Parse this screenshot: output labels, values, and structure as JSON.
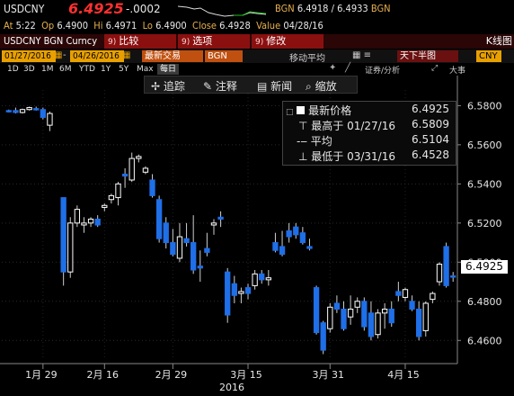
{
  "header": {
    "ticker": "USDCNY",
    "last": "6.4925",
    "change": "-.0002",
    "bid_label": "BGN",
    "bid": "6.4918",
    "ask": "6.4933",
    "ask_src": "BGN",
    "at_label": "At",
    "at_time": "5:22",
    "op_label": "Op",
    "open": "6.4900",
    "hi_label": "Hi",
    "high": "6.4971",
    "lo_label": "Lo",
    "low": "6.4900",
    "close_label": "Close",
    "close": "6.4928",
    "value_label": "Value",
    "value_date": "04/28/16"
  },
  "function_bar": {
    "security": "USDCNY BGN Curncy",
    "buttons": [
      {
        "num": "9)",
        "label": "比较"
      },
      {
        "num": "9)",
        "label": "选项"
      },
      {
        "num": "9)",
        "label": "修改"
      }
    ],
    "chart_label": "K线图"
  },
  "date_row": {
    "start": "01/27/2016",
    "end": "04/26/2016",
    "last_trade": "最新交易",
    "source": "BGN",
    "ma_label": "移动平均",
    "view": "天下半图",
    "currency": "CNY",
    "securities": "证券/分析",
    "zoom": "大事"
  },
  "periods": [
    "1D",
    "3D",
    "1M",
    "6M",
    "YTD",
    "1Y",
    "5Y",
    "Max"
  ],
  "period_selected": "",
  "freq": "每日",
  "toolbar": {
    "track": "追踪",
    "annotate": "注释",
    "news": "新闻",
    "zoom": "缩放"
  },
  "legend": {
    "last_label": "最新价格",
    "last_value": "6.4925",
    "high_label": "最高于 01/27/16",
    "high_value": "6.5809",
    "avg_label": "平均",
    "avg_value": "6.5104",
    "low_label": "最低于 03/31/16",
    "low_value": "6.4528"
  },
  "colors": {
    "up": "#ffffff",
    "down": "#1f6fe8",
    "last_price_color": "#ff3030"
  },
  "chart_data": {
    "type": "candlestick",
    "yticks": [
      "6.5800",
      "6.5600",
      "6.5400",
      "6.5200",
      "6.5000",
      "6.4800",
      "6.4600"
    ],
    "ylim": [
      6.45,
      6.588
    ],
    "xticks": [
      "1月 29",
      "2月 16",
      "2月 29",
      "3月 15",
      "3月 31",
      "4月 15"
    ],
    "x_year": "2016",
    "last_price_label": "6.4925",
    "candles": [
      [
        6.5775,
        6.578,
        6.5765,
        6.577
      ],
      [
        6.5775,
        6.579,
        6.576,
        6.5765
      ],
      [
        6.5765,
        6.5785,
        6.576,
        6.578
      ],
      [
        6.578,
        6.5795,
        6.5775,
        6.579
      ],
      [
        6.5785,
        6.5795,
        6.5775,
        6.578
      ],
      [
        6.578,
        6.579,
        6.573,
        6.574
      ],
      [
        6.57,
        6.577,
        6.567,
        6.576
      ],
      null,
      [
        6.533,
        6.533,
        6.488,
        6.495
      ],
      [
        6.495,
        6.523,
        6.492,
        6.52
      ],
      [
        6.52,
        6.529,
        6.518,
        6.527
      ],
      [
        6.519,
        6.523,
        6.515,
        6.52
      ],
      [
        6.52,
        6.523,
        6.518,
        6.522
      ],
      [
        6.522,
        6.524,
        6.518,
        6.519
      ],
      [
        6.528,
        6.53,
        6.526,
        6.529
      ],
      [
        6.532,
        6.535,
        6.53,
        6.534
      ],
      [
        6.533,
        6.541,
        6.529,
        6.54
      ],
      [
        6.545,
        6.548,
        6.538,
        6.544
      ],
      [
        6.542,
        6.556,
        6.541,
        6.553
      ],
      [
        6.553,
        6.555,
        6.551,
        6.554
      ],
      [
        6.546,
        6.549,
        6.545,
        6.548
      ],
      [
        6.542,
        6.545,
        6.533,
        6.534
      ],
      [
        6.532,
        6.534,
        6.51,
        6.512
      ],
      [
        6.52,
        6.523,
        6.507,
        6.51
      ],
      [
        6.51,
        6.517,
        6.503,
        6.504
      ],
      [
        6.502,
        6.52,
        6.5,
        6.513
      ],
      [
        6.512,
        6.52,
        6.508,
        6.51
      ],
      [
        6.51,
        6.524,
        6.494,
        6.496
      ],
      [
        6.498,
        6.506,
        6.49,
        6.497
      ],
      [
        6.507,
        6.515,
        6.503,
        6.505
      ],
      [
        6.519,
        6.522,
        6.514,
        6.52
      ],
      [
        6.523,
        6.526,
        6.518,
        6.522
      ],
      [
        6.495,
        6.497,
        6.469,
        6.473
      ],
      [
        6.489,
        6.493,
        6.479,
        6.483
      ],
      [
        6.484,
        6.487,
        6.479,
        6.485
      ],
      [
        6.487,
        6.489,
        6.481,
        6.484
      ],
      [
        6.488,
        6.496,
        6.486,
        6.494
      ],
      [
        6.494,
        6.496,
        6.489,
        6.491
      ],
      [
        6.491,
        6.496,
        6.488,
        6.492
      ],
      [
        6.51,
        6.515,
        6.505,
        6.506
      ],
      [
        6.508,
        6.516,
        6.503,
        6.504
      ],
      [
        6.516,
        6.52,
        6.51,
        6.513
      ],
      [
        6.518,
        6.52,
        6.512,
        6.514
      ],
      [
        6.515,
        6.518,
        6.509,
        6.51
      ],
      [
        6.508,
        6.512,
        6.506,
        6.507
      ],
      [
        6.487,
        6.488,
        6.463,
        6.464
      ],
      [
        6.469,
        6.47,
        6.453,
        6.455
      ],
      [
        6.466,
        6.479,
        6.464,
        6.477
      ],
      [
        6.479,
        6.483,
        6.474,
        6.476
      ],
      [
        6.476,
        6.48,
        6.465,
        6.466
      ],
      [
        6.472,
        6.483,
        6.468,
        6.476
      ],
      [
        6.477,
        6.482,
        6.474,
        6.48
      ],
      [
        6.48,
        6.482,
        6.465,
        6.467
      ],
      [
        6.474,
        6.48,
        6.46,
        6.462
      ],
      [
        6.463,
        6.476,
        6.461,
        6.474
      ],
      [
        6.474,
        6.479,
        6.466,
        6.476
      ],
      [
        6.476,
        6.48,
        6.467,
        6.469
      ],
      [
        6.485,
        6.49,
        6.48,
        6.483
      ],
      [
        6.482,
        6.487,
        6.48,
        6.486
      ],
      [
        6.48,
        6.483,
        6.475,
        6.476
      ],
      [
        6.476,
        6.48,
        6.46,
        6.462
      ],
      [
        6.465,
        6.48,
        6.462,
        6.479
      ],
      [
        6.481,
        6.485,
        6.479,
        6.484
      ],
      [
        6.49,
        6.5,
        6.488,
        6.499
      ],
      [
        6.508,
        6.51,
        6.487,
        6.488
      ],
      [
        6.493,
        6.495,
        6.49,
        6.4925
      ]
    ]
  }
}
